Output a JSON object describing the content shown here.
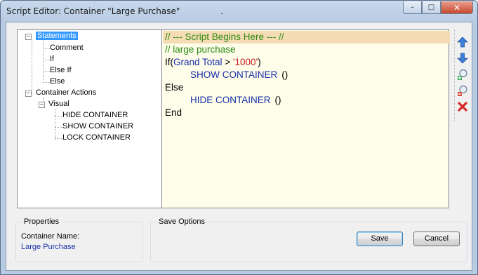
{
  "window": {
    "title": "Script Editor: Container \"Large Purchase\"",
    "title_dot": ".",
    "buttons": {
      "minimize": "–",
      "maximize": "□",
      "close": "✕"
    }
  },
  "tree": {
    "statements": "Statements",
    "comment": "Comment",
    "if": "If",
    "else_if": "Else If",
    "else": "Else",
    "container_actions": "Container Actions",
    "visual": "Visual",
    "hide_container": "HIDE CONTAINER",
    "show_container": "SHOW CONTAINER",
    "lock_container": "LOCK CONTAINER"
  },
  "script": {
    "line1": "// --- Script Begins Here --- //",
    "line2": "// large purchase",
    "line3": {
      "kw": "If",
      "open": "(",
      "field": "Grand Total",
      "op": " > ",
      "val": "'1000'",
      "close": ")"
    },
    "line4": {
      "action": "SHOW CONTAINER",
      "parens": "()"
    },
    "line5": "Else",
    "line6": {
      "action": "HIDE CONTAINER",
      "parens": "()"
    },
    "line7": "End"
  },
  "sidebar_icons": [
    "arrow-up-icon",
    "arrow-down-icon",
    "zoom-in-icon",
    "zoom-out-icon",
    "delete-icon"
  ],
  "properties": {
    "title": "Properties",
    "label": "Container Name:",
    "value": "Large Purchase"
  },
  "save_options": {
    "title": "Save Options",
    "save": "Save",
    "cancel": "Cancel"
  },
  "colors": {
    "accent": "#3399ff",
    "comment": "#2d8c15",
    "function": "#1a2fa8",
    "string": "#c2191f",
    "highlight": "#f5dcb4"
  }
}
